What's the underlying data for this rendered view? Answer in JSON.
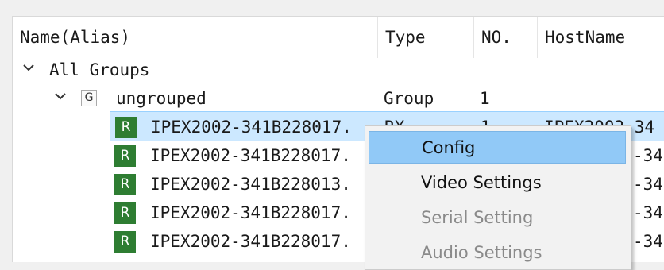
{
  "columns": {
    "name": "Name(Alias)",
    "type": "Type",
    "no": "NO.",
    "hostname": "HostName"
  },
  "tree": {
    "root": {
      "label": "All Groups"
    },
    "group": {
      "icon_letter": "G",
      "label": "ungrouped",
      "type": "Group",
      "no": "1"
    },
    "devices": [
      {
        "icon_letter": "R",
        "name": "IPEX2002-341B228017.",
        "type": "RX",
        "no": "1",
        "host": "IPEX2002-34"
      },
      {
        "icon_letter": "R",
        "name": "IPEX2002-341B228017.",
        "host": "-34"
      },
      {
        "icon_letter": "R",
        "name": "IPEX2002-341B228013.",
        "host": "-34"
      },
      {
        "icon_letter": "R",
        "name": "IPEX2002-341B228017.",
        "host": "-34"
      },
      {
        "icon_letter": "R",
        "name": "IPEX2002-341B228017.",
        "host": "-34"
      }
    ]
  },
  "context_menu": {
    "items": [
      {
        "label": "Config",
        "state": "highlighted"
      },
      {
        "label": "Video Settings",
        "state": "enabled"
      },
      {
        "label": "Serial Setting",
        "state": "disabled"
      },
      {
        "label": "Audio Settings",
        "state": "disabled"
      }
    ]
  },
  "colors": {
    "selection": "#cce8ff",
    "menu_highlight": "#91c9f7",
    "device_icon": "#2e7d32"
  }
}
